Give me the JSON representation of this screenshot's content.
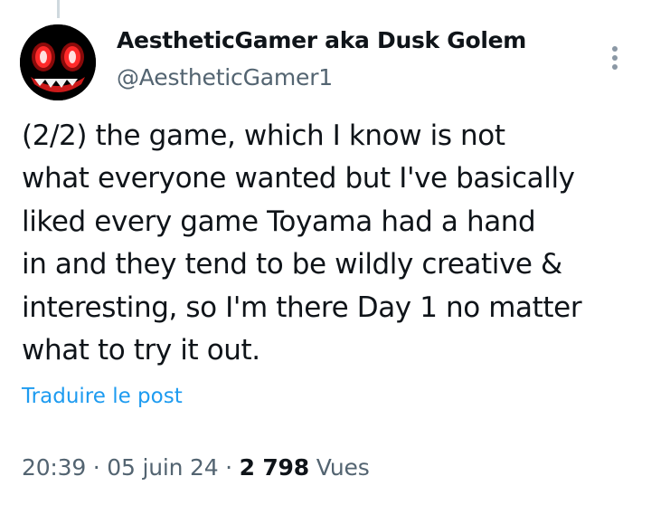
{
  "author": {
    "display_name": "AestheticGamer aka Dusk Golem",
    "handle": "@AestheticGamer1",
    "avatar_icon": "demon-face-avatar"
  },
  "tweet": {
    "lines": [
      "(2/2) the game, which I know is not",
      "what everyone wanted but I've basically",
      "liked every game Toyama had a hand",
      "in and they tend to be wildly creative &",
      "interesting, so I'm there Day 1 no matter",
      "what to try it out."
    ],
    "translate_label": "Traduire le post"
  },
  "meta": {
    "time": "20:39",
    "separator": "·",
    "date": "05 juin 24",
    "views_count": "2 798",
    "views_label": "Vues"
  },
  "colors": {
    "text": "#0f1419",
    "secondary": "#536471",
    "link": "#1d9bf0",
    "thread_line": "#cfd9de"
  }
}
